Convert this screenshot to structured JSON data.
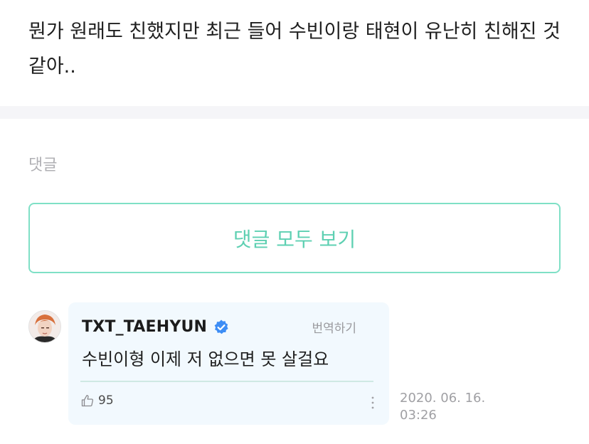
{
  "post": {
    "body": "뭔가 원래도 친했지만 최근 들어 수빈이랑 태현이 유난히 친해진 것 같아.."
  },
  "comments_section": {
    "heading": "댓글",
    "view_all_label": "댓글 모두 보기"
  },
  "comment": {
    "author": "TXT_TAEHYUN",
    "verified": true,
    "translate_label": "번역하기",
    "body": "수빈이형 이제 저 없으면 못 살걸요",
    "like_count": "95",
    "timestamp_date": "2020. 06. 16.",
    "timestamp_time": "03:26"
  },
  "colors": {
    "accent": "#5ed0b2",
    "accent_border": "#7fe0c6",
    "verified_blue": "#3d8df5",
    "card_bg": "#f2f9fe",
    "muted_text": "#b0b0b4"
  },
  "icons": {
    "verified": "verified-badge-icon",
    "like": "thumbs-up-icon",
    "more": "more-vertical-icon",
    "avatar": "user-avatar"
  }
}
